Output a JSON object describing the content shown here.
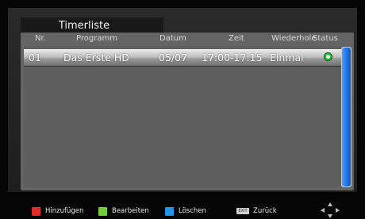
{
  "title": "Timerliste",
  "columns": {
    "nr": "Nr.",
    "programm": "Programm",
    "datum": "Datum",
    "zeit": "Zeit",
    "wiederhole": "Wiederhole",
    "status": "Status"
  },
  "rows": [
    {
      "nr": "01",
      "programm": "Das Erste HD",
      "datum": "05/07",
      "zeit": "17:00-17:15",
      "wiederhole": "Einmal",
      "status_icon": "clock-active-icon"
    }
  ],
  "footer": {
    "add_label": "Hinzufügen",
    "edit_label": "Bearbeiten",
    "delete_label": "Löschen",
    "exit_key_label": "EXIT",
    "back_label": "Zurück"
  },
  "colors": {
    "add": "#e12a2a",
    "edit": "#6fcc3a",
    "delete": "#1f96ee",
    "scrollbar": "#1e6fe6"
  }
}
